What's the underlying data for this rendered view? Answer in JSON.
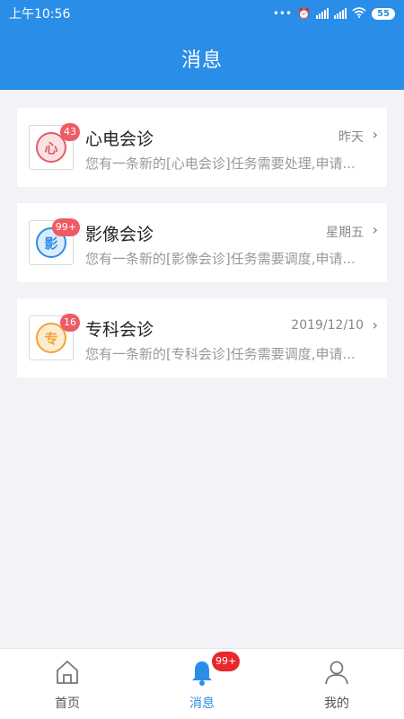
{
  "status_bar": {
    "time": "上午10:56",
    "battery": "55"
  },
  "header": {
    "title": "消息"
  },
  "messages": [
    {
      "icon_char": "心",
      "icon_color": "#e25b67",
      "icon_bg": "#fbe1e3",
      "badge": "43",
      "title": "心电会诊",
      "time": "昨天",
      "description": "您有一条新的[心电会诊]任务需要处理,申请..."
    },
    {
      "icon_char": "影",
      "icon_color": "#2a8ee8",
      "icon_bg": "#dcecfb",
      "badge": "99+",
      "title": "影像会诊",
      "time": "星期五",
      "description": "您有一条新的[影像会诊]任务需要调度,申请..."
    },
    {
      "icon_char": "专",
      "icon_color": "#f2a33a",
      "icon_bg": "#fdeccf",
      "badge": "16",
      "title": "专科会诊",
      "time": "2019/12/10",
      "description": "您有一条新的[专科会诊]任务需要调度,申请..."
    }
  ],
  "tabbar": {
    "tabs": [
      {
        "label": "首页",
        "icon": "home-icon"
      },
      {
        "label": "消息",
        "icon": "bell-icon",
        "badge": "99+"
      },
      {
        "label": "我的",
        "icon": "user-icon"
      }
    ]
  },
  "colors": {
    "primary": "#2a8ee8",
    "badge": "#ef5b64",
    "background": "#f3f2f6"
  }
}
